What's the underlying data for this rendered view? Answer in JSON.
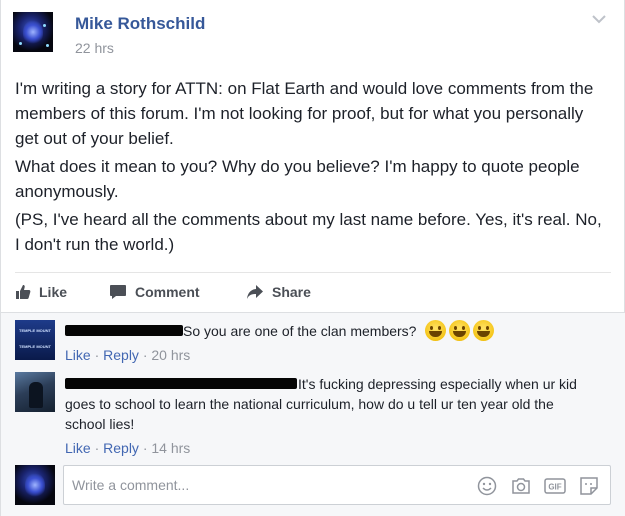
{
  "post": {
    "author": "Mike Rothschild",
    "time": "22 hrs",
    "paragraphs": [
      "I'm writing a story for ATTN: on Flat Earth and would love comments from the members of this forum. I'm not looking for proof, but for what you personally get out of your belief.",
      "What does it mean to you? Why do you believe? I'm happy to quote people anonymously.",
      "(PS, I've heard all the comments about my last name before. Yes, it's real. No, I don't run the world.)"
    ]
  },
  "actions": {
    "like": "Like",
    "comment": "Comment",
    "share": "Share"
  },
  "comments": [
    {
      "text": "So you are one of the clan members?",
      "like": "Like",
      "reply": "Reply",
      "time": "20 hrs",
      "avatar_text": [
        "TEMPLE MOUNT",
        "TEMPLE MOUNT"
      ]
    },
    {
      "text": "It's fucking depressing especially when ur kid goes to school to learn the national curriculum, how do u tell ur ten year old the school lies!",
      "like": "Like",
      "reply": "Reply",
      "time": "14 hrs"
    }
  ],
  "composer": {
    "placeholder": "Write a comment...",
    "icons": [
      "emoji-icon",
      "camera-icon",
      "gif-icon",
      "sticker-icon"
    ]
  },
  "colors": {
    "link": "#365899",
    "meta_link": "#4267b2",
    "meta_gray": "#90949c",
    "comments_bg": "#f6f7f9"
  }
}
